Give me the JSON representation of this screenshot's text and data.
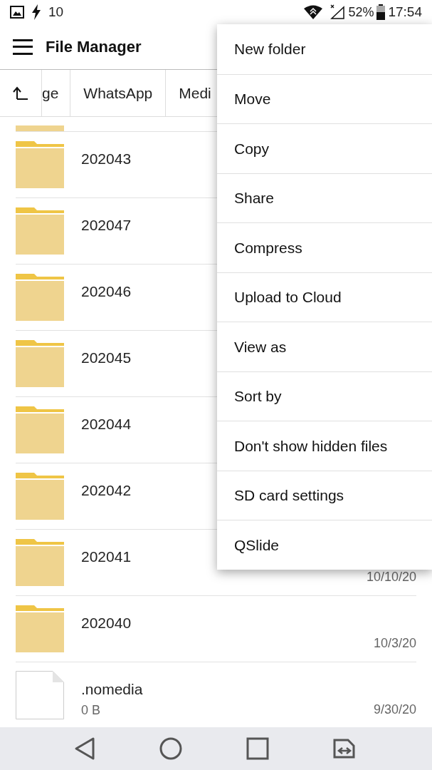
{
  "status_bar": {
    "notification_count": "10",
    "battery": "52%",
    "time": "17:54"
  },
  "app_bar": {
    "title": "File Manager"
  },
  "breadcrumbs": [
    "ge",
    "WhatsApp",
    "Medi"
  ],
  "files": [
    {
      "kind": "folder",
      "name": "202043"
    },
    {
      "kind": "folder",
      "name": "202047"
    },
    {
      "kind": "folder",
      "name": "202046"
    },
    {
      "kind": "folder",
      "name": "202045"
    },
    {
      "kind": "folder",
      "name": "202044"
    },
    {
      "kind": "folder",
      "name": "202042"
    },
    {
      "kind": "folder",
      "name": "202041",
      "date": "10/10/20"
    },
    {
      "kind": "folder",
      "name": "202040",
      "date": "10/3/20"
    },
    {
      "kind": "file",
      "name": ".nomedia",
      "size": "0 B",
      "date": "9/30/20"
    }
  ],
  "menu": [
    "New folder",
    "Move",
    "Copy",
    "Share",
    "Compress",
    "Upload to Cloud",
    "View as",
    "Sort by",
    "Don't show hidden files",
    "SD card settings",
    "QSlide"
  ]
}
